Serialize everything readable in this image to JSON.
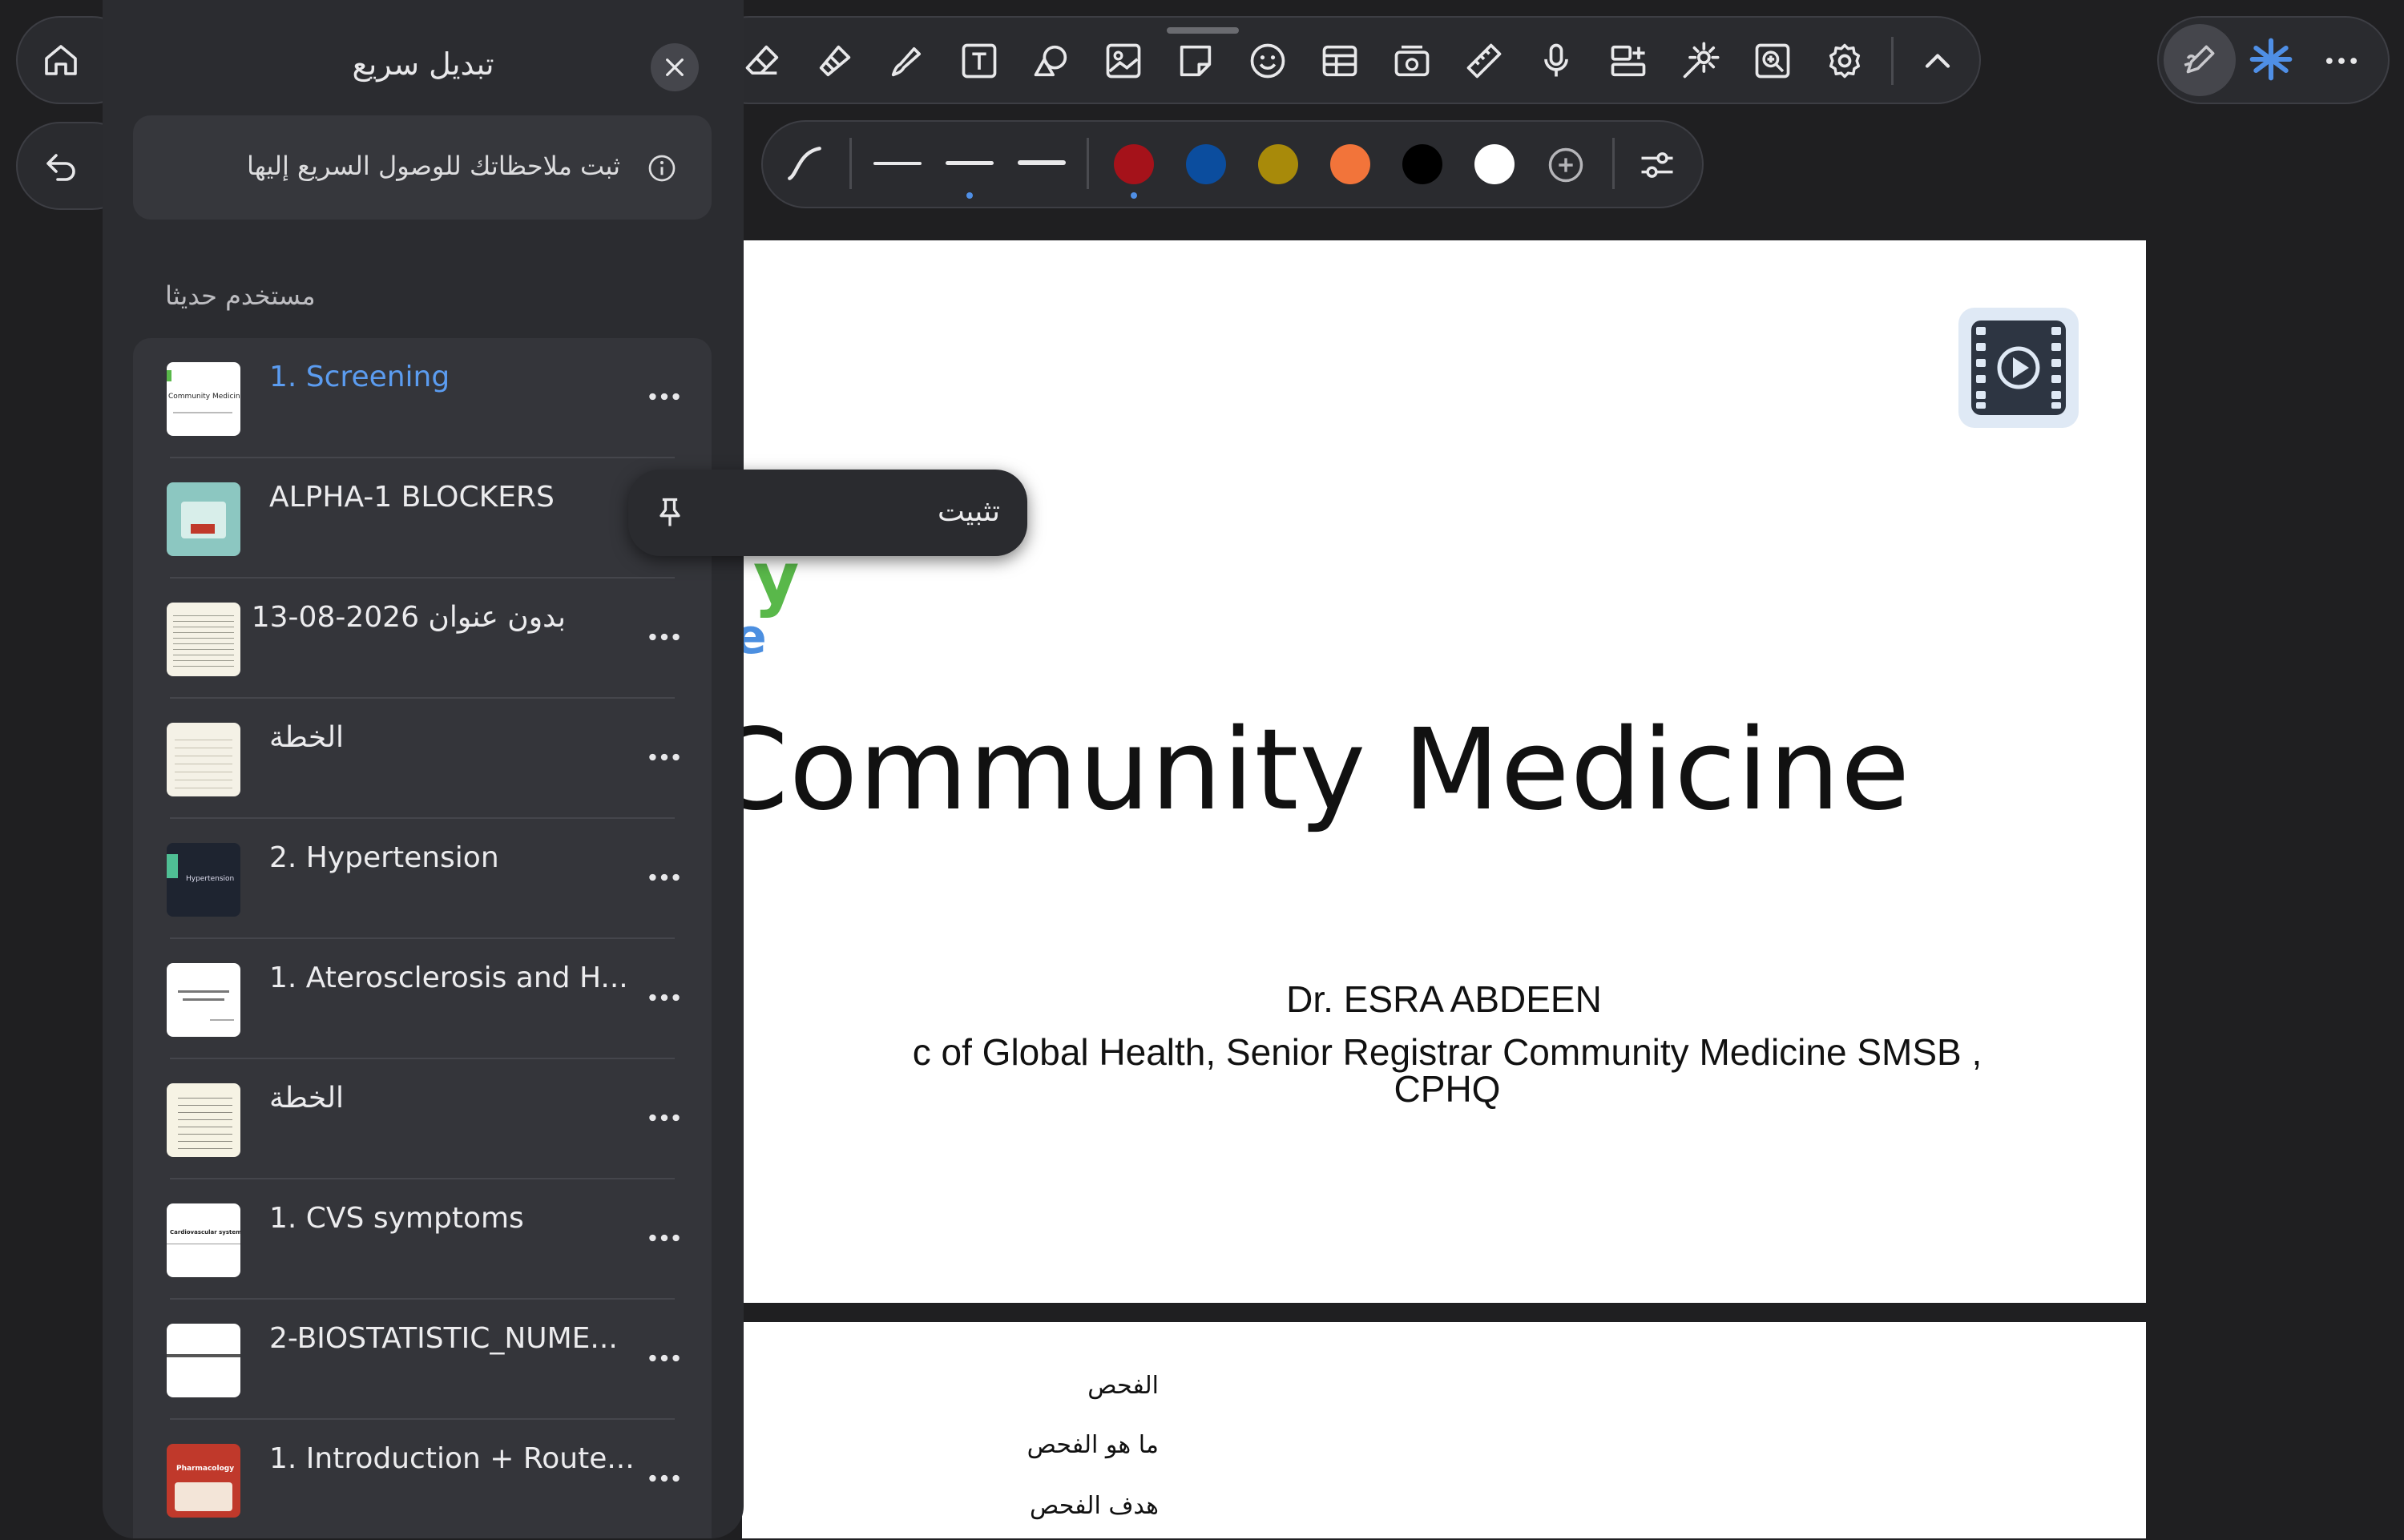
{
  "toolbar": {
    "tools": [
      "eraser-icon",
      "lasso-icon",
      "highlighter-icon",
      "text-icon",
      "shapes-icon",
      "image-icon",
      "sticky-note-icon",
      "sticker-icon",
      "table-icon",
      "media-icon",
      "ruler-icon",
      "microphone-icon",
      "add-page-icon",
      "laser-icon",
      "zoom-box-icon",
      "settings-icon",
      "collapse-icon"
    ],
    "right": [
      "pen-mode-icon",
      "ai-sparkle-icon",
      "more-icon"
    ]
  },
  "pen_bar": {
    "colors": [
      "#a5121a",
      "#0b4d9e",
      "#a88a0a",
      "#f2743a",
      "#000000",
      "#ffffff"
    ],
    "selected_color": "#a5121a"
  },
  "panel": {
    "title": "تبديل سريع",
    "info": "ثبت ملاحظاتك للوصول السريع إليها",
    "section": "مستخدم حديثا",
    "items": [
      {
        "label": "1. Screening",
        "active": true
      },
      {
        "label": "ALPHA-1 BLOCKERS"
      },
      {
        "label": "بدون عنوان 2026-08-13"
      },
      {
        "label": "الخطة"
      },
      {
        "label": "2. Hypertension"
      },
      {
        "label": "1. Aterosclerosis and H..."
      },
      {
        "label": "الخطة"
      },
      {
        "label": "1. CVS symptoms"
      },
      {
        "label": "2-BIOSTATISTIC_NUME..."
      },
      {
        "label": "1. Introduction + Route..."
      }
    ],
    "thumbs": {
      "screening": "Community Medicine",
      "hypertension": "Hypertension",
      "cvs": "Cardiovascular system",
      "pharma": "Pharmacology"
    }
  },
  "pin_popup": {
    "label": "تثبيت"
  },
  "document": {
    "title": "Community Medicine",
    "author": "Dr. ESRA ABDEEN",
    "subtitle_line1": "c of Global Health, Senior Registrar Community Medicine SMSB ,",
    "subtitle_line2": "CPHQ",
    "fragment_y": "y",
    "fragment_e": "e",
    "toc": [
      "الفحص",
      "ما هو الفحص",
      "هدف الفحص"
    ]
  }
}
